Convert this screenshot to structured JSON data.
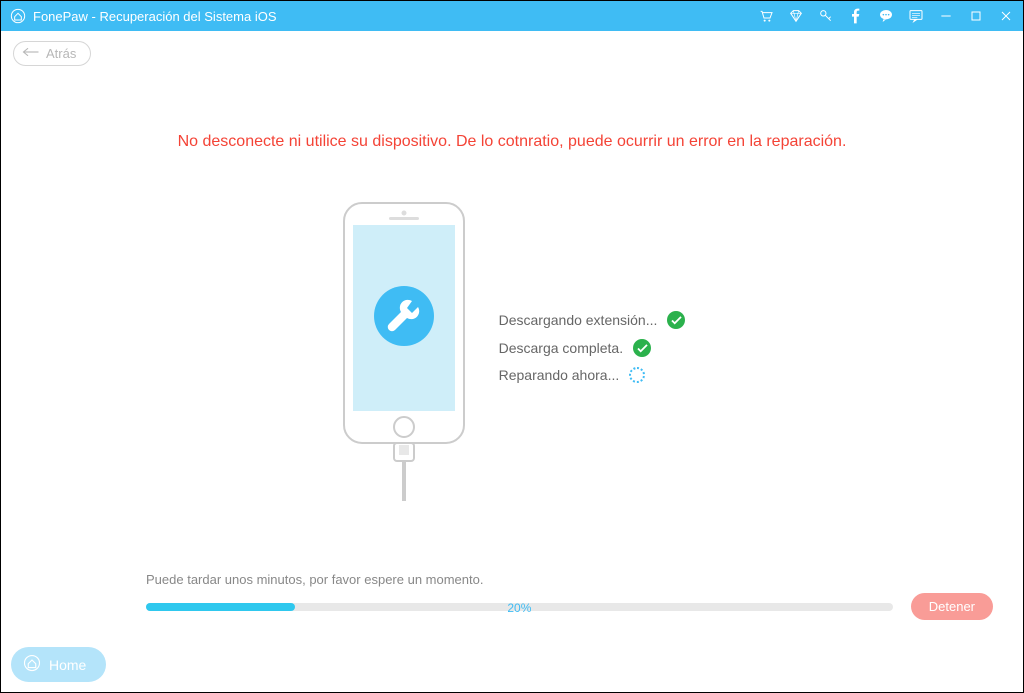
{
  "titlebar": {
    "app_title": "FonePaw - Recuperación del Sistema iOS"
  },
  "back_button_label": "Atrás",
  "warning_text": "No desconecte ni utilice su dispositivo. De lo cotnratio, puede ocurrir un error en la reparación.",
  "status": {
    "step1": "Descargando extensión...",
    "step2": "Descarga completa.",
    "step3": "Reparando ahora..."
  },
  "wait_text": "Puede tardar unos minutos, por favor espere un momento.",
  "progress": {
    "percent_label": "20%",
    "percent_value": 20
  },
  "stop_button_label": "Detener",
  "home_button_label": "Home",
  "colors": {
    "accent": "#3fbcf4",
    "danger": "#f44336",
    "success": "#2bb14c",
    "stop": "#f99c97"
  }
}
